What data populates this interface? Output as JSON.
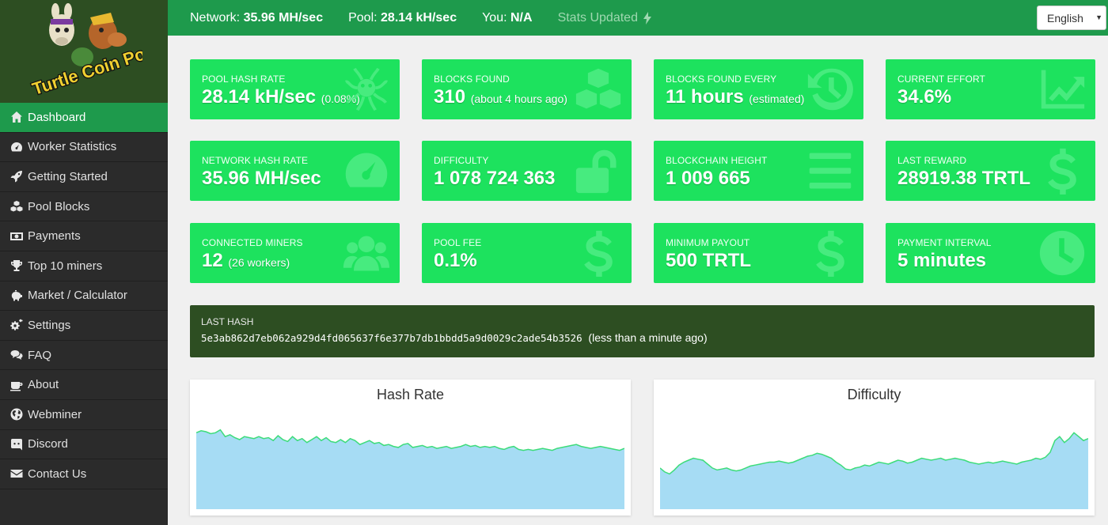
{
  "sidebar": {
    "logo_text": "Turtle Coin Pool",
    "items": [
      {
        "label": "Dashboard",
        "icon": "home-icon",
        "active": true
      },
      {
        "label": "Worker Statistics",
        "icon": "tachometer-icon"
      },
      {
        "label": "Getting Started",
        "icon": "rocket-icon"
      },
      {
        "label": "Pool Blocks",
        "icon": "cubes-icon"
      },
      {
        "label": "Payments",
        "icon": "money-icon"
      },
      {
        "label": "Top 10 miners",
        "icon": "trophy-icon"
      },
      {
        "label": "Market / Calculator",
        "icon": "piggy-bank-icon"
      },
      {
        "label": "Settings",
        "icon": "cogs-icon"
      },
      {
        "label": "FAQ",
        "icon": "comments-icon"
      },
      {
        "label": "About",
        "icon": "coffee-icon"
      },
      {
        "label": "Webminer",
        "icon": "globe-icon"
      },
      {
        "label": "Discord",
        "icon": "discord-icon"
      },
      {
        "label": "Contact Us",
        "icon": "envelope-icon"
      }
    ]
  },
  "topbar": {
    "network_label": "Network:",
    "network_value": "35.96 MH/sec",
    "pool_label": "Pool:",
    "pool_value": "28.14 kH/sec",
    "you_label": "You:",
    "you_value": "N/A",
    "stats_updated": "Stats Updated",
    "language": "English"
  },
  "cards": [
    {
      "label": "POOL HASH RATE",
      "value": "28.14 kH/sec",
      "sub": "(0.08%)",
      "icon": "bug-icon"
    },
    {
      "label": "BLOCKS FOUND",
      "value": "310",
      "sub": "(about 4 hours ago)",
      "icon": "cubes-icon"
    },
    {
      "label": "BLOCKS FOUND EVERY",
      "value": "11 hours",
      "sub": "(estimated)",
      "icon": "history-icon"
    },
    {
      "label": "CURRENT EFFORT",
      "value": "34.6%",
      "sub": "",
      "icon": "line-chart-icon"
    },
    {
      "label": "NETWORK HASH RATE",
      "value": "35.96 MH/sec",
      "sub": "",
      "icon": "tachometer-icon"
    },
    {
      "label": "DIFFICULTY",
      "value": "1 078 724 363",
      "sub": "",
      "icon": "unlock-icon"
    },
    {
      "label": "BLOCKCHAIN HEIGHT",
      "value": "1 009 665",
      "sub": "",
      "icon": "bars-icon"
    },
    {
      "label": "LAST REWARD",
      "value": "28919.38 TRTL",
      "sub": "",
      "icon": "dollar-icon"
    },
    {
      "label": "CONNECTED MINERS",
      "value": "12",
      "sub": "(26 workers)",
      "icon": "users-icon"
    },
    {
      "label": "POOL FEE",
      "value": "0.1%",
      "sub": "",
      "icon": "dollar-icon"
    },
    {
      "label": "MINIMUM PAYOUT",
      "value": "500 TRTL",
      "sub": "",
      "icon": "dollar-icon"
    },
    {
      "label": "PAYMENT INTERVAL",
      "value": "5 minutes",
      "sub": "",
      "icon": "clock-icon"
    }
  ],
  "last_hash": {
    "label": "LAST HASH",
    "hash": "5e3ab862d7eb062a929d4fd065637f6e377b7db1bbdd5a9d0029c2ade54b3526",
    "when": "(less than a minute ago)"
  },
  "charts": {
    "hash_rate_title": "Hash Rate",
    "difficulty_title": "Difficulty"
  },
  "chart_data": [
    {
      "type": "area",
      "title": "Hash Rate",
      "xlabel": "",
      "ylabel": "",
      "values": [
        78,
        80,
        79,
        77,
        78,
        81,
        74,
        76,
        73,
        71,
        74,
        73,
        72,
        74,
        72,
        73,
        70,
        75,
        71,
        69,
        74,
        70,
        72,
        68,
        71,
        74,
        70,
        73,
        69,
        68,
        71,
        68,
        72,
        70,
        66,
        68,
        70,
        67,
        68,
        65,
        66,
        64,
        63,
        66,
        67,
        63,
        64,
        65,
        63,
        64,
        62,
        63,
        64,
        62,
        63,
        64,
        66,
        64,
        65,
        63,
        64,
        63,
        64,
        62,
        61,
        63,
        64,
        61,
        60,
        61,
        60,
        61,
        62,
        61,
        60,
        62,
        63,
        64,
        65,
        66,
        64,
        63,
        62,
        63,
        64,
        63,
        62,
        61,
        60,
        62
      ]
    },
    {
      "type": "area",
      "title": "Difficulty",
      "xlabel": "",
      "ylabel": "",
      "values": [
        42,
        38,
        36,
        40,
        45,
        48,
        50,
        52,
        51,
        50,
        46,
        42,
        40,
        41,
        42,
        40,
        39,
        40,
        42,
        44,
        45,
        46,
        47,
        48,
        48,
        49,
        48,
        47,
        48,
        50,
        52,
        54,
        55,
        57,
        56,
        54,
        52,
        48,
        45,
        41,
        40,
        42,
        43,
        45,
        44,
        46,
        48,
        47,
        46,
        48,
        50,
        49,
        47,
        48,
        50,
        52,
        51,
        50,
        51,
        52,
        50,
        51,
        52,
        51,
        50,
        48,
        47,
        46,
        47,
        48,
        47,
        48,
        49,
        48,
        47,
        46,
        48,
        49,
        50,
        52,
        51,
        53,
        58,
        70,
        74,
        68,
        72,
        78,
        74,
        70,
        72
      ]
    }
  ]
}
